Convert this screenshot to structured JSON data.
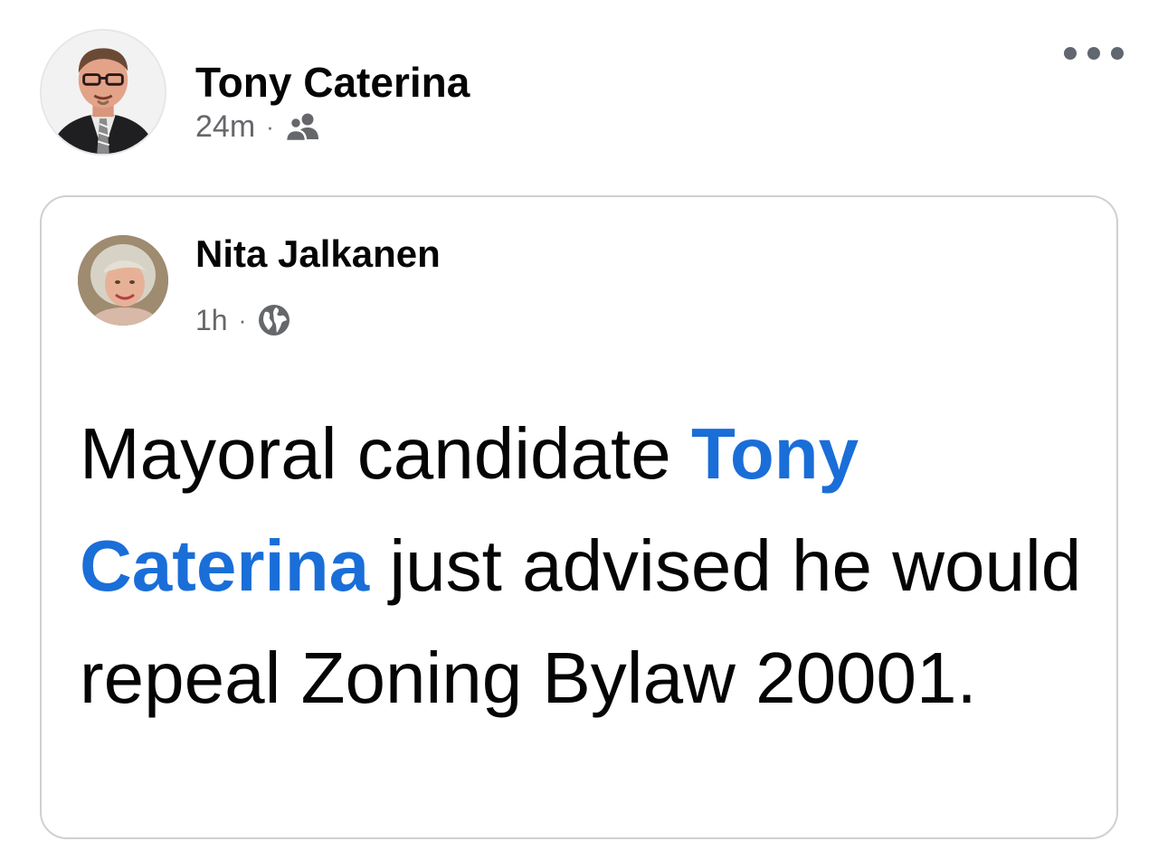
{
  "post": {
    "author": "Tony Caterina",
    "timestamp": "24m",
    "separator": "·",
    "audience_icon": "friends-icon",
    "more_icon": "more-options-icon"
  },
  "shared_post": {
    "author": "Nita Jalkanen",
    "timestamp": "1h",
    "separator": "·",
    "audience_icon": "globe-icon",
    "text": {
      "prefix": "Mayoral candidate ",
      "mention": "Tony Caterina",
      "suffix": " just advised he would repeal Zoning Bylaw 20001."
    }
  },
  "colors": {
    "mention": "#1a6ed8",
    "meta_text": "#65676b",
    "card_border": "#ced0d4"
  }
}
